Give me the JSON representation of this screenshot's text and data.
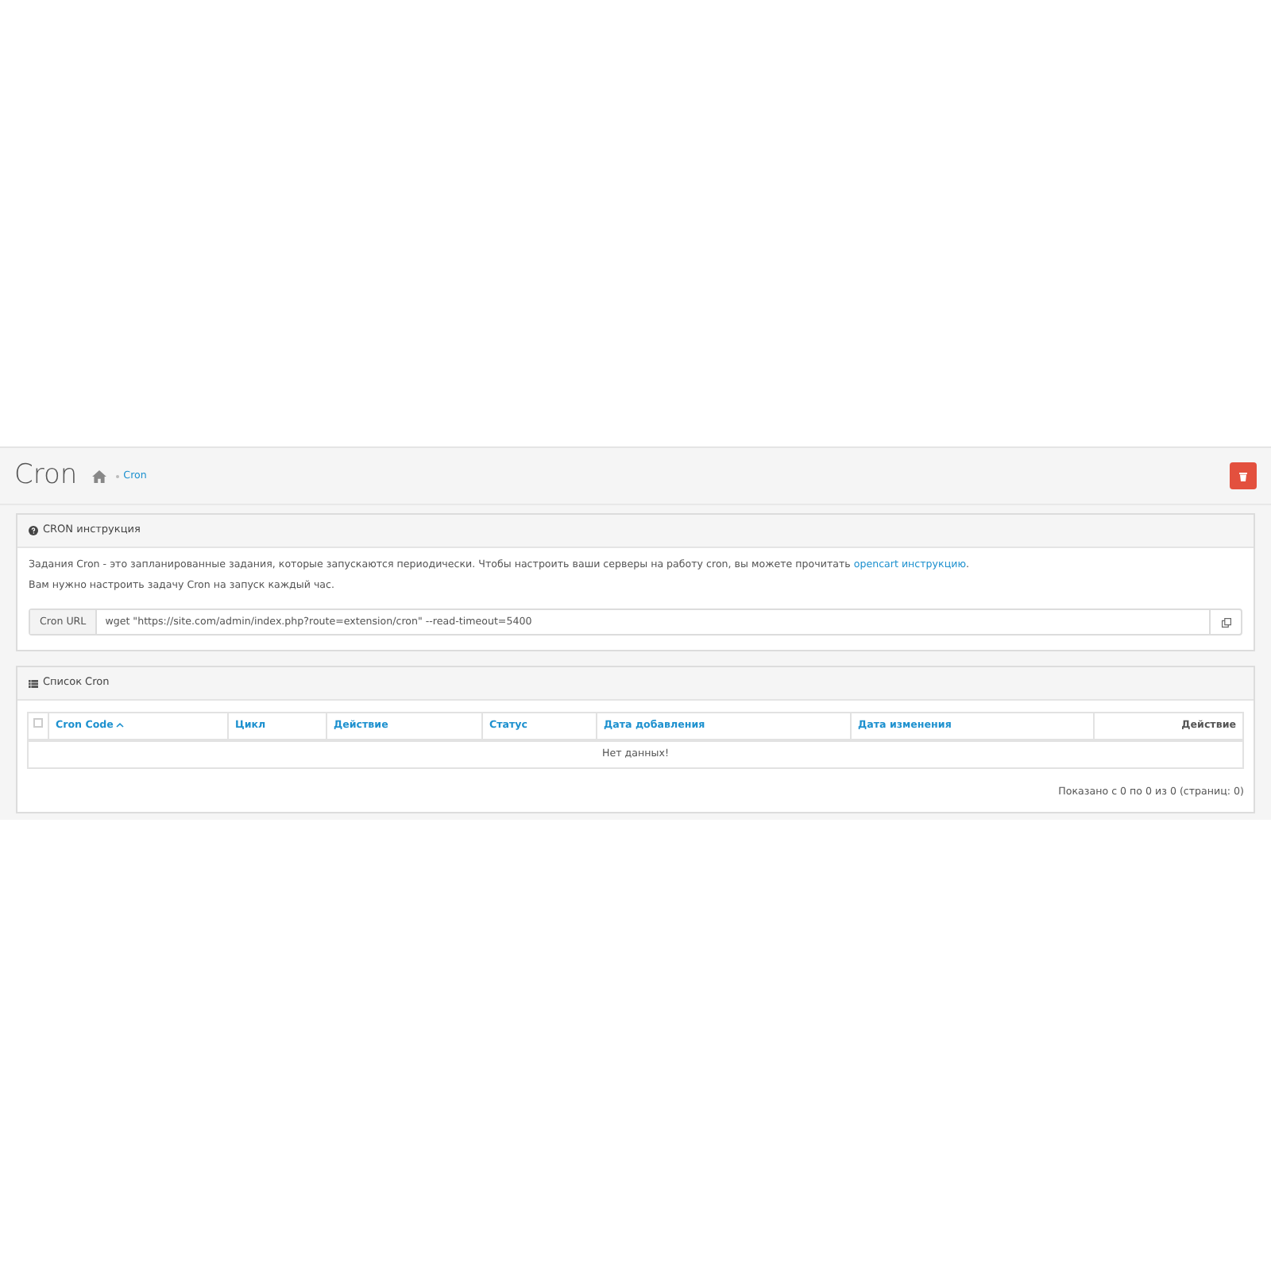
{
  "page_header": {
    "title": "Cron",
    "breadcrumb": [
      "Cron"
    ]
  },
  "instruction_panel": {
    "title": "CRON инструкция",
    "text": "Задания Cron - это запланированные задания, которые запускаются периодически. Чтобы настроить ваши серверы на работу cron, вы можете прочитать",
    "link": "opencart инструкцию",
    "link_after": ".",
    "note": "Вам нужно настроить задачу Cron на запуск каждый час.",
    "cron_url": {
      "label": "Cron URL",
      "value": "wget \"https://site.com/admin/index.php?route=extension/cron\" --read-timeout=5400"
    }
  },
  "list_panel": {
    "title": "Список Cron",
    "select_all": {
      "checked": false
    },
    "columns": [
      {
        "label": "Cron Code",
        "kind": "link",
        "sorted": true
      },
      {
        "label": "Цикл",
        "kind": "link",
        "sorted": false
      },
      {
        "label": "Действие",
        "kind": "link",
        "sorted": false
      },
      {
        "label": "Статус",
        "kind": "link",
        "sorted": false
      },
      {
        "label": "Дата добавления",
        "kind": "link",
        "sorted": false
      },
      {
        "label": "Дата изменения",
        "kind": "link",
        "sorted": false
      },
      {
        "label": "Действие",
        "kind": "plain",
        "sorted": false
      }
    ],
    "empty_text": "Нет данных!",
    "pagination": "Показано с 0 по 0 из 0 (страниц: 0)"
  }
}
